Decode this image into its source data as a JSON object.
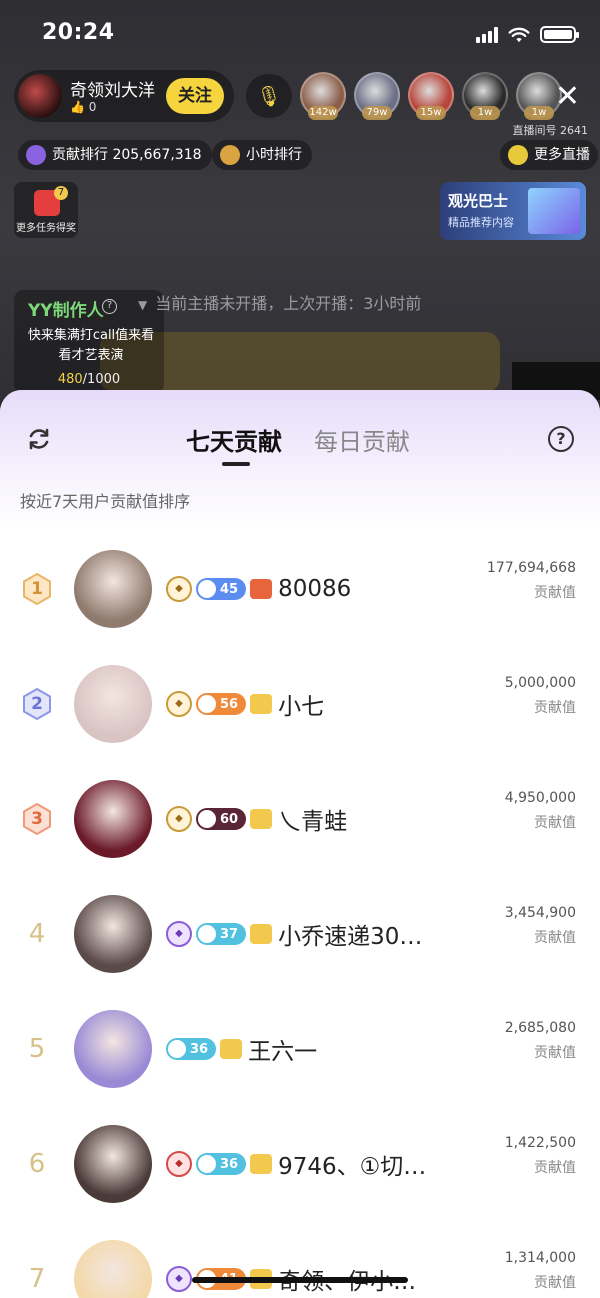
{
  "status_bar": {
    "time": "20:24"
  },
  "host": {
    "name": "奇领刘大洋",
    "likes": "0",
    "follow_label": "关注"
  },
  "viewers": [
    {
      "badge": "142w",
      "color": "#8b5e4a"
    },
    {
      "badge": "79w",
      "color": "#6c6f86"
    },
    {
      "badge": "15w",
      "color": "#b8453a"
    },
    {
      "badge": "1w",
      "color": "#2a2a2a"
    },
    {
      "badge": "1w",
      "color": "#555"
    }
  ],
  "room": {
    "id_label": "直播间号 2641"
  },
  "pills": {
    "contribution": "贡献排行 205,667,318",
    "hourly": "小时排行",
    "more_live": "更多直播"
  },
  "task": {
    "badge": "7",
    "label": "更多任务得奖"
  },
  "banner": {
    "title": "观光巴士",
    "subtitle": "精品推荐内容"
  },
  "producer": {
    "title": "YY制作人",
    "desc": "快来集满打call值来看看才艺表演",
    "progress_current": "480",
    "progress_total": "/1000"
  },
  "offline_text": "当前主播未开播，上次开播：3小时前",
  "sheet": {
    "tabs": [
      "七天贡献",
      "每日贡献"
    ],
    "subtitle": "按近7天用户贡献值排序",
    "help_icon": "?",
    "value_label": "贡献值",
    "rows": [
      {
        "rank": "1",
        "name": "80086",
        "level": "45",
        "value": "177,694,668",
        "level_color": "#5b8df0",
        "shirt": "#e8643b",
        "shield": "",
        "avatar": "#8f7a6e"
      },
      {
        "rank": "2",
        "name": "小七",
        "level": "56",
        "value": "5,000,000",
        "level_color": "#f08a3b",
        "shirt": "#f2c94c",
        "shield": "",
        "avatar": "#d9c4c4"
      },
      {
        "rank": "3",
        "name": "乀青蛙",
        "level": "60",
        "value": "4,950,000",
        "level_color": "#5a2535",
        "shirt": "#f2c94c",
        "shield": "",
        "avatar": "#6b1a2a"
      },
      {
        "rank": "4",
        "name": "小乔速递30…",
        "level": "37",
        "value": "3,454,900",
        "level_color": "#52c1e0",
        "shirt": "#f2c94c",
        "shield": "purple",
        "avatar": "#5a4a4a"
      },
      {
        "rank": "5",
        "name": "王六一",
        "level": "36",
        "value": "2,685,080",
        "level_color": "#52c1e0",
        "shirt": "#f2c94c",
        "shield": "none",
        "avatar": "#9a8ad6"
      },
      {
        "rank": "6",
        "name": "9746、①切…",
        "level": "36",
        "value": "1,422,500",
        "level_color": "#52c1e0",
        "shirt": "#f2c94c",
        "shield": "red",
        "avatar": "#4a3a38"
      },
      {
        "rank": "7",
        "name": "奇领、伊小…",
        "level": "41",
        "value": "1,314,000",
        "level_color": "#f08a3b",
        "shirt": "#f2c94c",
        "shield": "purple",
        "avatar": "#f3d8a8"
      }
    ]
  }
}
